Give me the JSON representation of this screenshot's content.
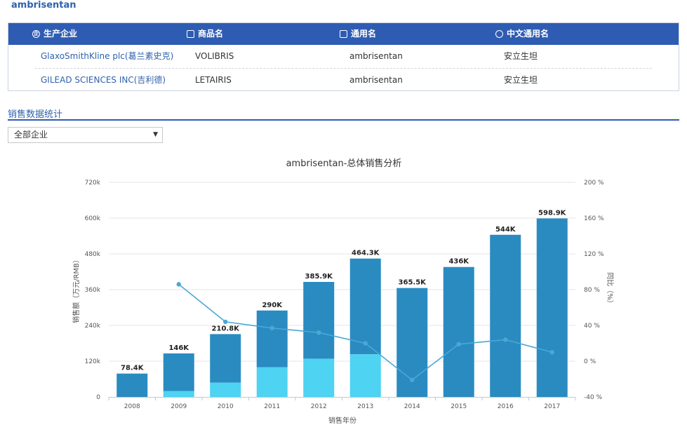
{
  "page_title": "ambrisentan",
  "table": {
    "headers": [
      {
        "label": "生产企业",
        "icon": "company-icon"
      },
      {
        "label": "商品名",
        "icon": "bag-icon"
      },
      {
        "label": "通用名",
        "icon": "gift-icon"
      },
      {
        "label": "中文通用名",
        "icon": "target-icon"
      }
    ],
    "rows": [
      [
        "GlaxoSmithKline plc(葛兰素史克)",
        "VOLIBRIS",
        "ambrisentan",
        "安立生坦"
      ],
      [
        "GILEAD SCIENCES INC(吉利德)",
        "LETAIRIS",
        "ambrisentan",
        "安立生坦"
      ]
    ]
  },
  "section_title": "销售数据统计",
  "filter": {
    "selected": "全部企业"
  },
  "colors": {
    "header_bg": "#2f5cb3",
    "bar_dark": "#2a8bc1",
    "bar_light": "#4ed3f2",
    "line": "#4aa8d6"
  },
  "chart_data": {
    "type": "bar",
    "title": "ambrisentan-总体销售分析",
    "xlabel": "销售年份",
    "ylabel": "销售额（万元/RMB）",
    "y2label": "同比（%）",
    "categories": [
      "2008",
      "2009",
      "2010",
      "2011",
      "2012",
      "2013",
      "2014",
      "2015",
      "2016",
      "2017"
    ],
    "ylim": [
      0,
      720000
    ],
    "yticks": [
      "0",
      "120k",
      "240k",
      "360k",
      "480k",
      "600k",
      "720k"
    ],
    "y2lim": [
      -40,
      200
    ],
    "y2ticks": [
      "-40 %",
      "0 %",
      "40 %",
      "80 %",
      "120 %",
      "160 %",
      "200 %"
    ],
    "totals": [
      78400,
      146000,
      210800,
      290000,
      385900,
      464300,
      365500,
      436000,
      544000,
      598900
    ],
    "total_labels": [
      "78.4K",
      "146K",
      "210.8K",
      "290K",
      "385.9K",
      "464.3K",
      "365.5K",
      "436K",
      "544K",
      "598.9K"
    ],
    "series": [
      {
        "values": [
          0,
          20000,
          48000,
          100000,
          128000,
          143000,
          0,
          0,
          0,
          0
        ]
      },
      {
        "values": [
          78400,
          126000,
          162800,
          190000,
          257900,
          321300,
          365500,
          436000,
          544000,
          598900
        ]
      }
    ],
    "yoy": [
      null,
      86,
      44,
      37,
      32,
      20,
      -21,
      19,
      24,
      10
    ]
  }
}
